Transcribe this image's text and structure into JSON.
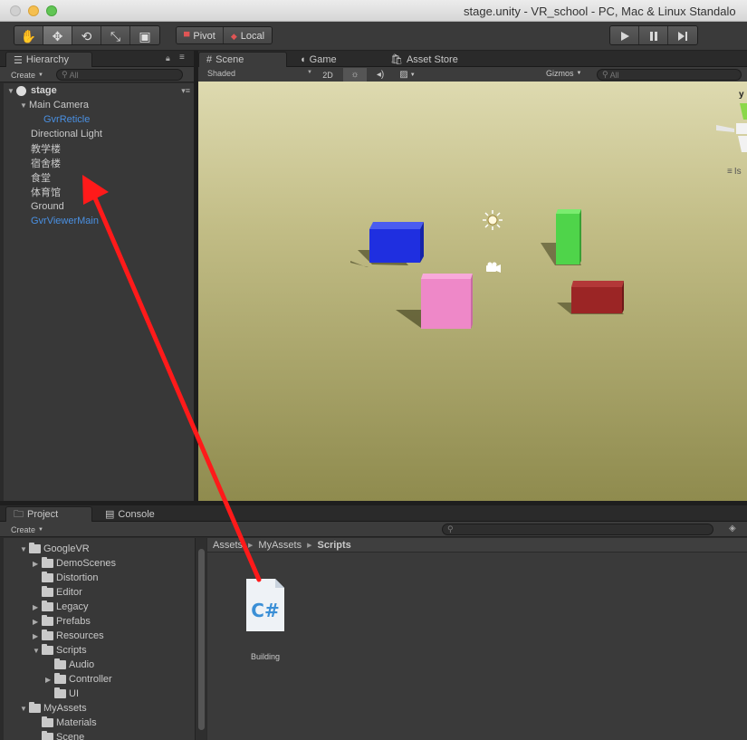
{
  "window": {
    "title": "stage.unity - VR_school - PC, Mac & Linux Standalo"
  },
  "toolbar": {
    "tools": [
      "hand-icon",
      "move-icon",
      "rotate-icon",
      "scale-icon",
      "rect-icon"
    ],
    "pivot_label": "Pivot",
    "local_label": "Local",
    "play_icons": [
      "play-icon",
      "pause-icon",
      "step-icon"
    ]
  },
  "hierarchy": {
    "tab_label": "Hierarchy",
    "create_label": "Create",
    "search_placeholder": "All",
    "scene_name": "stage",
    "items": [
      {
        "label": "Main Camera",
        "depth": 1,
        "expanded": true,
        "prefab": false
      },
      {
        "label": "GvrReticle",
        "depth": 2,
        "prefab": true
      },
      {
        "label": "Directional Light",
        "depth": 1,
        "prefab": false
      },
      {
        "label": "教学楼",
        "depth": 1,
        "prefab": false
      },
      {
        "label": "宿舍楼",
        "depth": 1,
        "prefab": false
      },
      {
        "label": "食堂",
        "depth": 1,
        "prefab": false
      },
      {
        "label": "体育馆",
        "depth": 1,
        "prefab": false
      },
      {
        "label": "Ground",
        "depth": 1,
        "prefab": false
      },
      {
        "label": "GvrViewerMain",
        "depth": 1,
        "prefab": true
      }
    ]
  },
  "scene_view": {
    "tabs": [
      {
        "label": "Scene",
        "icon": "grid-icon",
        "active": true
      },
      {
        "label": "Game",
        "icon": "pacman-icon",
        "active": false
      },
      {
        "label": "Asset Store",
        "icon": "bag-icon",
        "active": false
      }
    ],
    "shading_mode": "Shaded",
    "mode_2d_label": "2D",
    "gizmos_label": "Gizmos",
    "search_placeholder": "All",
    "axis_label_y": "y",
    "iso_label": "Is",
    "cube_colors": {
      "blue": "#2538e0",
      "green": "#4fd44a",
      "pink": "#ee88c8",
      "red": "#9b2525"
    }
  },
  "project": {
    "tabs": [
      {
        "label": "Project",
        "icon": "folder-icon",
        "active": true
      },
      {
        "label": "Console",
        "icon": "console-icon",
        "active": false
      }
    ],
    "create_label": "Create",
    "tree": [
      {
        "label": "GoogleVR",
        "depth": 0,
        "arrow": "down"
      },
      {
        "label": "DemoScenes",
        "depth": 1,
        "arrow": "right"
      },
      {
        "label": "Distortion",
        "depth": 1,
        "arrow": "none"
      },
      {
        "label": "Editor",
        "depth": 1,
        "arrow": "none"
      },
      {
        "label": "Legacy",
        "depth": 1,
        "arrow": "right"
      },
      {
        "label": "Prefabs",
        "depth": 1,
        "arrow": "right"
      },
      {
        "label": "Resources",
        "depth": 1,
        "arrow": "right"
      },
      {
        "label": "Scripts",
        "depth": 1,
        "arrow": "down"
      },
      {
        "label": "Audio",
        "depth": 2,
        "arrow": "none"
      },
      {
        "label": "Controller",
        "depth": 2,
        "arrow": "right"
      },
      {
        "label": "UI",
        "depth": 2,
        "arrow": "none"
      },
      {
        "label": "MyAssets",
        "depth": 0,
        "arrow": "down"
      },
      {
        "label": "Materials",
        "depth": 1,
        "arrow": "none"
      },
      {
        "label": "Scene",
        "depth": 1,
        "arrow": "none"
      }
    ],
    "breadcrumb": [
      "Assets",
      "MyAssets",
      "Scripts"
    ],
    "files": [
      {
        "name": "Building",
        "type": "C#"
      }
    ]
  },
  "annotation": {
    "arrow_color": "#ff1a1a"
  }
}
